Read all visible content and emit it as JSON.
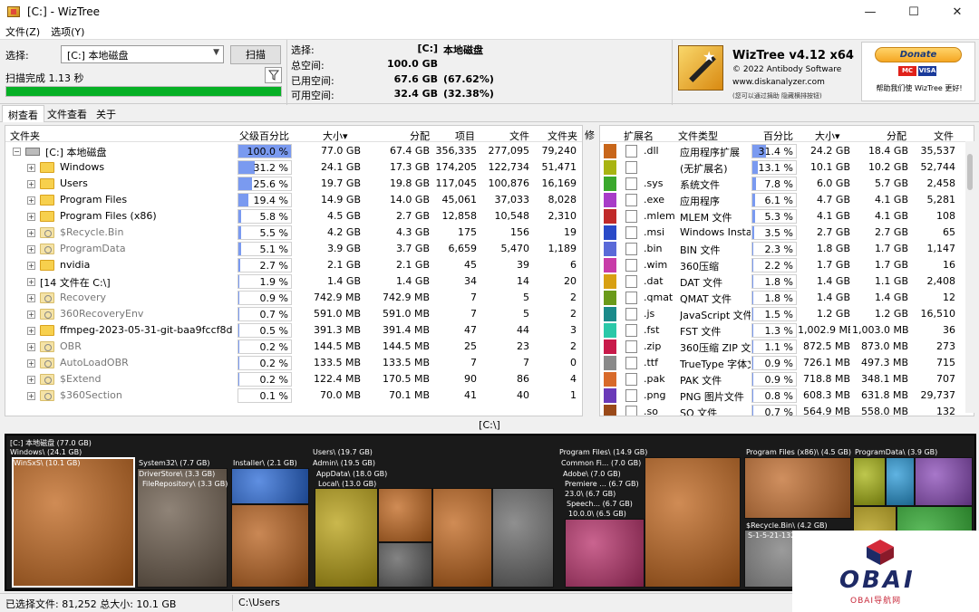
{
  "window": {
    "title": "[C:] - WizTree",
    "min": "—",
    "max": "☐",
    "close": "✕"
  },
  "menu": [
    "文件(Z)",
    "选项(Y)"
  ],
  "toolbar": {
    "select_label": "选择:",
    "drive_value": "[C:] 本地磁盘",
    "scan_label": "扫描",
    "scan_status": "扫描完成 1.13 秒",
    "progress": 100
  },
  "info": {
    "selected_k": "选择:",
    "selected_v": "[C:]",
    "selected_p": "本地磁盘",
    "total_k": "总空间:",
    "total_v": "100.0 GB",
    "used_k": "已用空间:",
    "used_v": "67.6 GB",
    "used_p": "(67.62%)",
    "free_k": "可用空间:",
    "free_v": "32.4 GB",
    "free_p": "(32.38%)"
  },
  "logo": {
    "title": "WizTree v4.12 x64",
    "copyright": "© 2022 Antibody Software",
    "url": "www.diskanalyzer.com",
    "hint": "(您可以通过捐助 隐藏横排按钮)"
  },
  "donate": {
    "label": "Donate",
    "text": "帮助我们使 WizTree 更好!"
  },
  "tabs": [
    "树查看",
    "文件查看",
    "关于"
  ],
  "tree": {
    "headers": {
      "folder": "文件夹",
      "pct": "父级百分比",
      "size": "大小▾",
      "alloc": "分配",
      "items": "项目",
      "files": "文件",
      "folders": "文件夹",
      "mod": "修"
    },
    "rows": [
      {
        "name": "[C:] 本地磁盘",
        "pct": "100.0 %",
        "p": 100,
        "size": "77.0 GB",
        "alloc": "67.4 GB",
        "items": "356,335",
        "files": "277,095",
        "folders": "79,240",
        "level": 0,
        "type": "drive"
      },
      {
        "name": "Windows",
        "pct": "31.2 %",
        "p": 31.2,
        "size": "24.1 GB",
        "alloc": "17.3 GB",
        "items": "174,205",
        "files": "122,734",
        "folders": "51,471",
        "level": 1,
        "type": "folder"
      },
      {
        "name": "Users",
        "pct": "25.6 %",
        "p": 25.6,
        "size": "19.7 GB",
        "alloc": "19.8 GB",
        "items": "117,045",
        "files": "100,876",
        "folders": "16,169",
        "level": 1,
        "type": "folder"
      },
      {
        "name": "Program Files",
        "pct": "19.4 %",
        "p": 19.4,
        "size": "14.9 GB",
        "alloc": "14.0 GB",
        "items": "45,061",
        "files": "37,033",
        "folders": "8,028",
        "level": 1,
        "type": "folder"
      },
      {
        "name": "Program Files (x86)",
        "pct": "5.8 %",
        "p": 5.8,
        "size": "4.5 GB",
        "alloc": "2.7 GB",
        "items": "12,858",
        "files": "10,548",
        "folders": "2,310",
        "level": 1,
        "type": "folder"
      },
      {
        "name": "$Recycle.Bin",
        "pct": "5.5 %",
        "p": 5.5,
        "size": "4.2 GB",
        "alloc": "4.3 GB",
        "items": "175",
        "files": "156",
        "folders": "19",
        "level": 1,
        "type": "sys"
      },
      {
        "name": "ProgramData",
        "pct": "5.1 %",
        "p": 5.1,
        "size": "3.9 GB",
        "alloc": "3.7 GB",
        "items": "6,659",
        "files": "5,470",
        "folders": "1,189",
        "level": 1,
        "type": "folder-grey"
      },
      {
        "name": "nvidia",
        "pct": "2.7 %",
        "p": 2.7,
        "size": "2.1 GB",
        "alloc": "2.1 GB",
        "items": "45",
        "files": "39",
        "folders": "6",
        "level": 1,
        "type": "folder"
      },
      {
        "name": "[14 文件在 C:\\]",
        "pct": "1.9 %",
        "p": 1.9,
        "size": "1.4 GB",
        "alloc": "1.4 GB",
        "items": "34",
        "files": "14",
        "folders": "20",
        "level": 1,
        "type": "none"
      },
      {
        "name": "Recovery",
        "pct": "0.9 %",
        "p": 0.9,
        "size": "742.9 MB",
        "alloc": "742.9 MB",
        "items": "7",
        "files": "5",
        "folders": "2",
        "level": 1,
        "type": "folder-grey"
      },
      {
        "name": "360RecoveryEnv",
        "pct": "0.7 %",
        "p": 0.7,
        "size": "591.0 MB",
        "alloc": "591.0 MB",
        "items": "7",
        "files": "5",
        "folders": "2",
        "level": 1,
        "type": "folder-grey"
      },
      {
        "name": "ffmpeg-2023-05-31-git-baa9fccf8d-full_b",
        "pct": "0.5 %",
        "p": 0.5,
        "size": "391.3 MB",
        "alloc": "391.4 MB",
        "items": "47",
        "files": "44",
        "folders": "3",
        "level": 1,
        "type": "folder"
      },
      {
        "name": "OBR",
        "pct": "0.2 %",
        "p": 0.2,
        "size": "144.5 MB",
        "alloc": "144.5 MB",
        "items": "25",
        "files": "23",
        "folders": "2",
        "level": 1,
        "type": "folder-grey"
      },
      {
        "name": "AutoLoadOBR",
        "pct": "0.2 %",
        "p": 0.2,
        "size": "133.5 MB",
        "alloc": "133.5 MB",
        "items": "7",
        "files": "7",
        "folders": "0",
        "level": 1,
        "type": "sys"
      },
      {
        "name": "$Extend",
        "pct": "0.2 %",
        "p": 0.2,
        "size": "122.4 MB",
        "alloc": "170.5 MB",
        "items": "90",
        "files": "86",
        "folders": "4",
        "level": 1,
        "type": "sys"
      },
      {
        "name": "$360Section",
        "pct": "0.1 %",
        "p": 0.1,
        "size": "70.0 MB",
        "alloc": "70.1 MB",
        "items": "41",
        "files": "40",
        "folders": "1",
        "level": 1,
        "type": "sys"
      }
    ]
  },
  "ext": {
    "headers": {
      "ext": "扩展名",
      "type": "文件类型",
      "pct": "百分比",
      "size": "大小▾",
      "alloc": "分配",
      "files": "文件"
    },
    "rows": [
      {
        "color": "#c8661a",
        "ext": ".dll",
        "type": "应用程序扩展",
        "pct": "31.4 %",
        "p": 31.4,
        "size": "24.2 GB",
        "alloc": "18.4 GB",
        "files": "35,537"
      },
      {
        "color": "#a8b412",
        "ext": "",
        "type": "(无扩展名)",
        "pct": "13.1 %",
        "p": 13.1,
        "size": "10.1 GB",
        "alloc": "10.2 GB",
        "files": "52,744"
      },
      {
        "color": "#3aa82c",
        "ext": ".sys",
        "type": "系统文件",
        "pct": "7.8 %",
        "p": 7.8,
        "size": "6.0 GB",
        "alloc": "5.7 GB",
        "files": "2,458"
      },
      {
        "color": "#a83cc8",
        "ext": ".exe",
        "type": "应用程序",
        "pct": "6.1 %",
        "p": 6.1,
        "size": "4.7 GB",
        "alloc": "4.1 GB",
        "files": "5,281"
      },
      {
        "color": "#c02a2a",
        "ext": ".mlem",
        "type": "MLEM 文件",
        "pct": "5.3 %",
        "p": 5.3,
        "size": "4.1 GB",
        "alloc": "4.1 GB",
        "files": "108"
      },
      {
        "color": "#2a4ac8",
        "ext": ".msi",
        "type": "Windows Installe",
        "pct": "3.5 %",
        "p": 3.5,
        "size": "2.7 GB",
        "alloc": "2.7 GB",
        "files": "65"
      },
      {
        "color": "#5a6ad8",
        "ext": ".bin",
        "type": "BIN 文件",
        "pct": "2.3 %",
        "p": 2.3,
        "size": "1.8 GB",
        "alloc": "1.7 GB",
        "files": "1,147"
      },
      {
        "color": "#c83ca8",
        "ext": ".wim",
        "type": "360压缩",
        "pct": "2.2 %",
        "p": 2.2,
        "size": "1.7 GB",
        "alloc": "1.7 GB",
        "files": "16"
      },
      {
        "color": "#d8a012",
        "ext": ".dat",
        "type": "DAT 文件",
        "pct": "1.8 %",
        "p": 1.8,
        "size": "1.4 GB",
        "alloc": "1.1 GB",
        "files": "2,408"
      },
      {
        "color": "#6a9a1a",
        "ext": ".qmat",
        "type": "QMAT 文件",
        "pct": "1.8 %",
        "p": 1.8,
        "size": "1.4 GB",
        "alloc": "1.4 GB",
        "files": "12"
      },
      {
        "color": "#1a8a8a",
        "ext": ".js",
        "type": "JavaScript 文件",
        "pct": "1.5 %",
        "p": 1.5,
        "size": "1.2 GB",
        "alloc": "1.2 GB",
        "files": "16,510"
      },
      {
        "color": "#2ac8a8",
        "ext": ".fst",
        "type": "FST 文件",
        "pct": "1.3 %",
        "p": 1.3,
        "size": "1,002.9 MB",
        "alloc": "1,003.0 MB",
        "files": "36"
      },
      {
        "color": "#c81a4a",
        "ext": ".zip",
        "type": "360压缩 ZIP 文件",
        "pct": "1.1 %",
        "p": 1.1,
        "size": "872.5 MB",
        "alloc": "873.0 MB",
        "files": "273"
      },
      {
        "color": "#8a8a8a",
        "ext": ".ttf",
        "type": "TrueType 字体文",
        "pct": "0.9 %",
        "p": 0.9,
        "size": "726.1 MB",
        "alloc": "497.3 MB",
        "files": "715"
      },
      {
        "color": "#d86a2a",
        "ext": ".pak",
        "type": "PAK 文件",
        "pct": "0.9 %",
        "p": 0.9,
        "size": "718.8 MB",
        "alloc": "348.1 MB",
        "files": "707"
      },
      {
        "color": "#6a3ab8",
        "ext": ".png",
        "type": "PNG 图片文件",
        "pct": "0.8 %",
        "p": 0.8,
        "size": "608.3 MB",
        "alloc": "631.8 MB",
        "files": "29,737"
      },
      {
        "color": "#9a4a1a",
        "ext": ".so",
        "type": "SO 文件",
        "pct": "0.7 %",
        "p": 0.7,
        "size": "564.9 MB",
        "alloc": "558.0 MB",
        "files": "132"
      }
    ]
  },
  "path": "[C:\\]",
  "treemap": {
    "root": "[C:] 本地磁盘 (77.0 GB)",
    "windows": "Windows\\ (24.1 GB)",
    "winsxs": "WinSxS\\ (10.1 GB)",
    "system32": "System32\\ (7.7 GB)",
    "driverstore": "DriverStore\\ (3.3 GB)",
    "filerepo": "FileRepository\\ (3.3 GB)",
    "installer": "Installer\\ (2.1 GB)",
    "users": "Users\\ (19.7 GB)",
    "admin": "Admin\\ (19.5 GB)",
    "appdata": "AppData\\ (18.0 GB)",
    "local": "Local\\ (13.0 GB)",
    "progfiles": "Program Files\\ (14.9 GB)",
    "commonfi": "Common Fi... (7.0 GB)",
    "adobe": "Adobe\\ (7.0 GB)",
    "premiere": "Premiere ... (6.7 GB)",
    "v230": "23.0\\ (6.7 GB)",
    "speech": "Speech... (6.7 GB)",
    "v1000": "10.0.0\\ (6.5 GB)",
    "progx86": "Program Files (x86)\\ (4.5 GB)",
    "progdata": "ProgramData\\ (3.9 GB)",
    "recycle": "$Recycle.Bin\\ (4.2 GB)",
    "sid": "S-1-5-21-1328..."
  },
  "status": {
    "selected": "已选择文件: 81,252  总大小: 10.1 GB",
    "path": "C:\\Users"
  },
  "watermark": {
    "brand": "OBAI",
    "sub": "OBAI导航网"
  }
}
